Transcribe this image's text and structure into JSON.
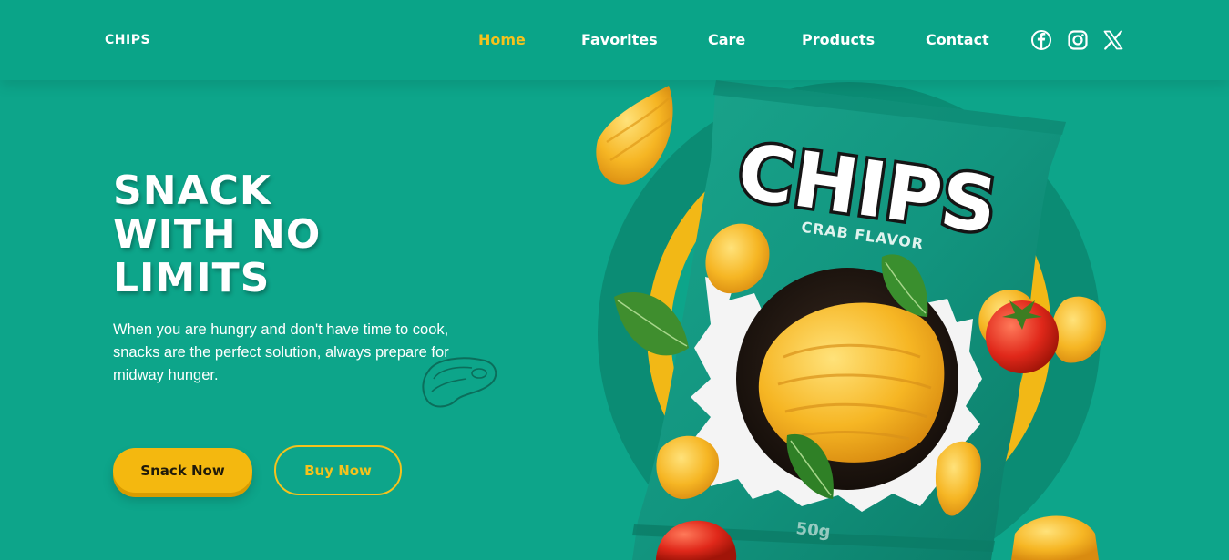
{
  "brand": {
    "logo_text": "CHIPS"
  },
  "nav": {
    "items": [
      {
        "label": "Home",
        "active": true
      },
      {
        "label": "Favorites",
        "active": false
      },
      {
        "label": "Care",
        "active": false
      },
      {
        "label": "Products",
        "active": false
      },
      {
        "label": "Contact",
        "active": false
      }
    ],
    "social_icons": [
      "facebook-icon",
      "instagram-icon",
      "x-twitter-icon"
    ]
  },
  "hero": {
    "title_lines": [
      "SNACK",
      "WITH NO",
      "LIMITS"
    ],
    "description_lines": [
      "When you are hungry and don't have time to cook,",
      "snacks are the perfect solution, always prepare for",
      "midway hunger."
    ],
    "primary_button": "Snack Now",
    "secondary_button": "Buy Now"
  },
  "product": {
    "bag_brand": "CHIPS",
    "flavor": "CRAB FLAVOR",
    "weight": "50g"
  },
  "colors": {
    "background": "#0da58a",
    "accent": "#f6c21c",
    "bag": "#109c85",
    "text": "#ffffff"
  }
}
